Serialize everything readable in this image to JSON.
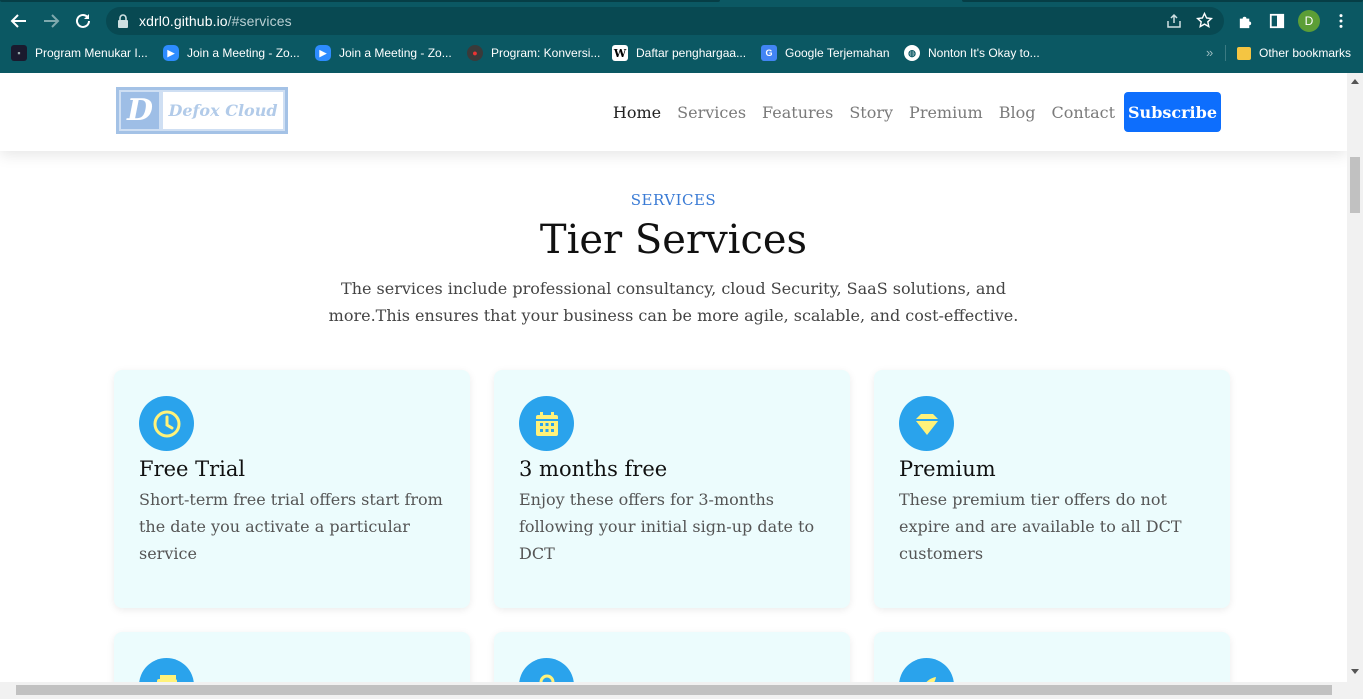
{
  "browser": {
    "url_host": "xdrl0.github.io",
    "url_path": "/#services",
    "profile_initial": "D",
    "bookmarks": [
      {
        "label": "Program Menukar I...",
        "icon": "dark-app-icon",
        "color": "#1a1a2e"
      },
      {
        "label": "Join a Meeting - Zo...",
        "icon": "zoom-icon",
        "color": "#2d8cff"
      },
      {
        "label": "Join a Meeting - Zo...",
        "icon": "zoom-icon",
        "color": "#2d8cff"
      },
      {
        "label": "Program: Konversi...",
        "icon": "red-app-icon",
        "color": "#3a3a3a"
      },
      {
        "label": "Daftar penghargaa...",
        "icon": "wikipedia-icon",
        "color": "#ffffff"
      },
      {
        "label": "Google Terjemahan",
        "icon": "google-translate-icon",
        "color": "#4285f4"
      },
      {
        "label": "Nonton It's Okay to...",
        "icon": "globe-icon",
        "color": "#ffffff"
      }
    ],
    "other_bookmarks": "Other bookmarks",
    "more_chevron": "»"
  },
  "site": {
    "logo_mark": "D",
    "logo_text": "Defox Cloud",
    "nav": [
      {
        "label": "Home",
        "active": true
      },
      {
        "label": "Services",
        "active": false
      },
      {
        "label": "Features",
        "active": false
      },
      {
        "label": "Story",
        "active": false
      },
      {
        "label": "Premium",
        "active": false
      },
      {
        "label": "Blog",
        "active": false
      },
      {
        "label": "Contact",
        "active": false
      }
    ],
    "subscribe_label": "Subscribe"
  },
  "services": {
    "label": "SERVICES",
    "title": "Tier Services",
    "description": "The services include professional consultancy, cloud Security, SaaS solutions, and more.This ensures that your business can be more agile, scalable, and cost-effective.",
    "cards": [
      {
        "icon": "clock-icon",
        "title": "Free Trial",
        "description": "Short-term free trial offers start from the date you activate a particular service"
      },
      {
        "icon": "calendar-icon",
        "title": "3 months free",
        "description": "Enjoy these offers for 3-months following your initial sign-up date to DCT"
      },
      {
        "icon": "gem-icon",
        "title": "Premium",
        "description": "These premium tier offers do not expire and are available to all DCT customers"
      }
    ],
    "partial_cards": [
      {
        "icon": "wallet-icon"
      },
      {
        "icon": "key-icon"
      },
      {
        "icon": "rocket-icon"
      }
    ]
  },
  "colors": {
    "chrome": "#0b5863",
    "accent": "#0d6efd",
    "icon_bg": "#2aa3ec",
    "icon_fg": "#fff27a",
    "card_bg": "#ecfcfd"
  }
}
